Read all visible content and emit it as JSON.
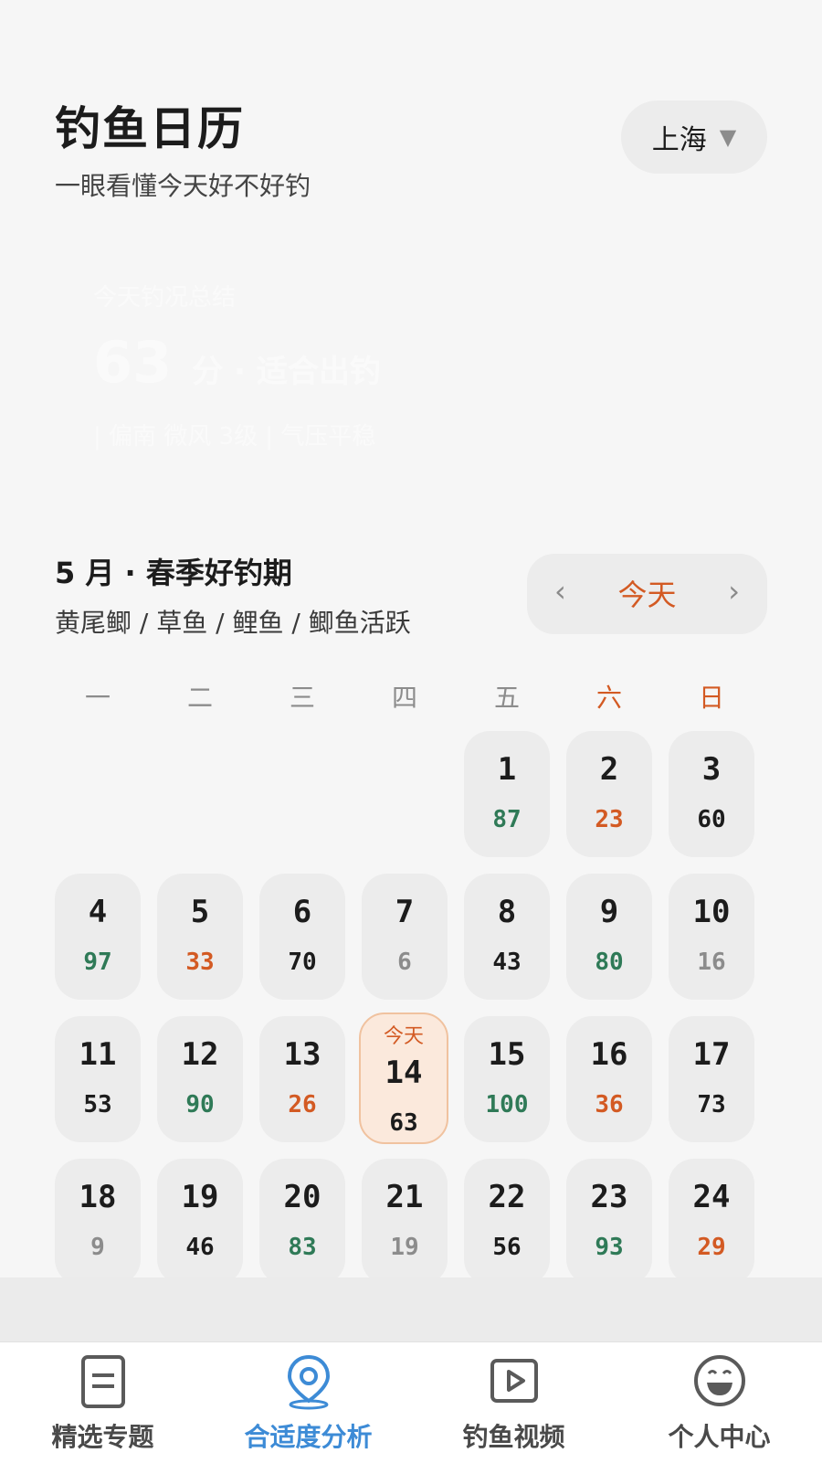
{
  "header": {
    "title": "钓鱼日历",
    "subtitle": "一眼看懂今天好不好钓",
    "city": "上海",
    "city_arrow": "▼"
  },
  "summary": {
    "label": "今天钓况总结",
    "score": "63",
    "level": "分 · 适合出钓",
    "detail": "| 偏南 微风 3级 | 气压平稳"
  },
  "month": {
    "title": "5 月 · 春季好钓期",
    "fish": "黄尾鲫 / 草鱼 / 鲤鱼 / 鲫鱼活跃",
    "nav_prev": "‹",
    "nav_today": "今天",
    "nav_next": "›"
  },
  "weekdays": [
    {
      "label": "一",
      "weekend": false
    },
    {
      "label": "二",
      "weekend": false
    },
    {
      "label": "三",
      "weekend": false
    },
    {
      "label": "四",
      "weekend": false
    },
    {
      "label": "五",
      "weekend": false
    },
    {
      "label": "六",
      "weekend": true
    },
    {
      "label": "日",
      "weekend": true
    }
  ],
  "calendar": {
    "first_weekday_index": 4,
    "today": 14,
    "today_label": "今天",
    "days": [
      {
        "day": "1",
        "score": "87",
        "level": "good"
      },
      {
        "day": "2",
        "score": "23",
        "level": "bad"
      },
      {
        "day": "3",
        "score": "60",
        "level": "normal"
      },
      {
        "day": "4",
        "score": "97",
        "level": "good"
      },
      {
        "day": "5",
        "score": "33",
        "level": "bad"
      },
      {
        "day": "6",
        "score": "70",
        "level": "normal"
      },
      {
        "day": "7",
        "score": "6",
        "level": "muted"
      },
      {
        "day": "8",
        "score": "43",
        "level": "normal"
      },
      {
        "day": "9",
        "score": "80",
        "level": "good"
      },
      {
        "day": "10",
        "score": "16",
        "level": "muted"
      },
      {
        "day": "11",
        "score": "53",
        "level": "normal"
      },
      {
        "day": "12",
        "score": "90",
        "level": "good"
      },
      {
        "day": "13",
        "score": "26",
        "level": "bad"
      },
      {
        "day": "14",
        "score": "63",
        "level": "normal"
      },
      {
        "day": "15",
        "score": "100",
        "level": "good"
      },
      {
        "day": "16",
        "score": "36",
        "level": "bad"
      },
      {
        "day": "17",
        "score": "73",
        "level": "normal"
      },
      {
        "day": "18",
        "score": "9",
        "level": "muted"
      },
      {
        "day": "19",
        "score": "46",
        "level": "normal"
      },
      {
        "day": "20",
        "score": "83",
        "level": "good"
      },
      {
        "day": "21",
        "score": "19",
        "level": "muted"
      },
      {
        "day": "22",
        "score": "56",
        "level": "normal"
      },
      {
        "day": "23",
        "score": "93",
        "level": "good"
      },
      {
        "day": "24",
        "score": "29",
        "level": "bad"
      }
    ]
  },
  "colors": {
    "good": "#2f7a57",
    "bad": "#d35a23",
    "normal": "#1c1c1c",
    "muted": "#8c8c8c",
    "accent": "#d35a23",
    "tab_active": "#3d8bd6"
  },
  "tabs": [
    {
      "label": "精选专题",
      "icon": "document-icon",
      "active": false
    },
    {
      "label": "合适度分析",
      "icon": "location-pin-icon",
      "active": true
    },
    {
      "label": "钓鱼视频",
      "icon": "video-play-icon",
      "active": false
    },
    {
      "label": "个人中心",
      "icon": "smiley-face-icon",
      "active": false
    }
  ]
}
